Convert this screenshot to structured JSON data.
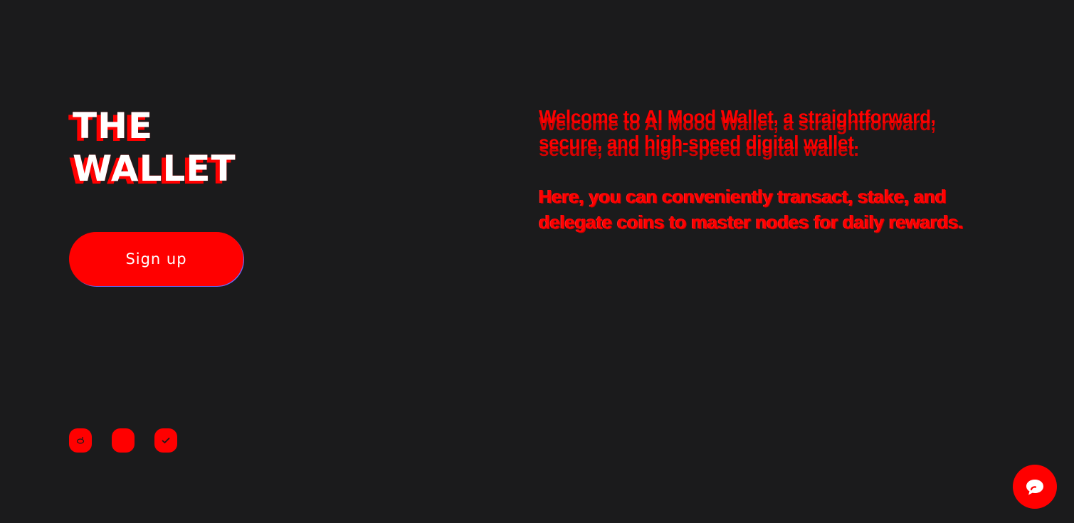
{
  "logo": {
    "line1": "THE",
    "line2": "WALLET"
  },
  "signup": {
    "label": "Sign up"
  },
  "intro": {
    "paragraph1": "Welcome to AI Mood Wallet, a straightforward, secure, and high-speed digital wallet.",
    "paragraph2": "Here, you can conveniently transact, stake, and delegate coins to master nodes for daily rewards."
  },
  "socials": [
    {
      "icon": "reddit-icon"
    },
    {
      "icon": "github-icon"
    },
    {
      "icon": "telegram-icon"
    }
  ],
  "chat": {
    "icon": "chat-bubble-icon"
  },
  "colors": {
    "background": "#1b1b1c",
    "accent": "#ff0000",
    "text_white": "#ffffff"
  }
}
